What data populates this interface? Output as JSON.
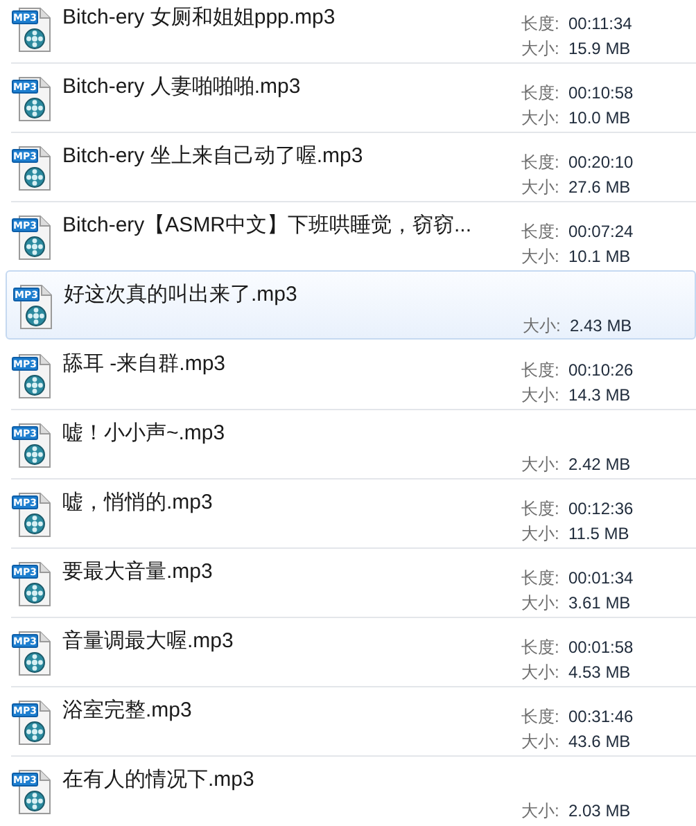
{
  "files": [
    {
      "name": "Bitch-ery 女厕和姐姐ppp.mp3",
      "icon_text": "MP3",
      "length_label": "长度:",
      "length": "00:11:34",
      "size_label": "大小:",
      "size": "15.9 MB",
      "selected": false
    },
    {
      "name": "Bitch-ery 人妻啪啪啪.mp3",
      "icon_text": "MP3",
      "length_label": "长度:",
      "length": "00:10:58",
      "size_label": "大小:",
      "size": "10.0 MB",
      "selected": false
    },
    {
      "name": "Bitch-ery 坐上来自己动了喔.mp3",
      "icon_text": "MP3",
      "length_label": "长度:",
      "length": "00:20:10",
      "size_label": "大小:",
      "size": "27.6 MB",
      "selected": false
    },
    {
      "name": "Bitch-ery【ASMR中文】下班哄睡觉，窃窃...",
      "icon_text": "MP3",
      "length_label": "长度:",
      "length": "00:07:24",
      "size_label": "大小:",
      "size": "10.1 MB",
      "selected": false
    },
    {
      "name": "好这次真的叫出来了.mp3",
      "icon_text": "MP3",
      "size_label": "大小:",
      "size": "2.43 MB",
      "selected": true
    },
    {
      "name": "舔耳 -来自群.mp3",
      "icon_text": "MP3",
      "length_label": "长度:",
      "length": "00:10:26",
      "size_label": "大小:",
      "size": "14.3 MB",
      "selected": false
    },
    {
      "name": "嘘！小小声~.mp3",
      "icon_text": "MP3",
      "size_label": "大小:",
      "size": "2.42 MB",
      "selected": false
    },
    {
      "name": "嘘，悄悄的.mp3",
      "icon_text": "MP3",
      "length_label": "长度:",
      "length": "00:12:36",
      "size_label": "大小:",
      "size": "11.5 MB",
      "selected": false
    },
    {
      "name": "要最大音量.mp3",
      "icon_text": "MP3",
      "length_label": "长度:",
      "length": "00:01:34",
      "size_label": "大小:",
      "size": "3.61 MB",
      "selected": false
    },
    {
      "name": "音量调最大喔.mp3",
      "icon_text": "MP3",
      "length_label": "长度:",
      "length": "00:01:58",
      "size_label": "大小:",
      "size": "4.53 MB",
      "selected": false
    },
    {
      "name": "浴室完整.mp3",
      "icon_text": "MP3",
      "length_label": "长度:",
      "length": "00:31:46",
      "size_label": "大小:",
      "size": "43.6 MB",
      "selected": false
    },
    {
      "name": "在有人的情况下.mp3",
      "icon_text": "MP3",
      "size_label": "大小:",
      "size": "2.03 MB",
      "selected": false
    }
  ]
}
